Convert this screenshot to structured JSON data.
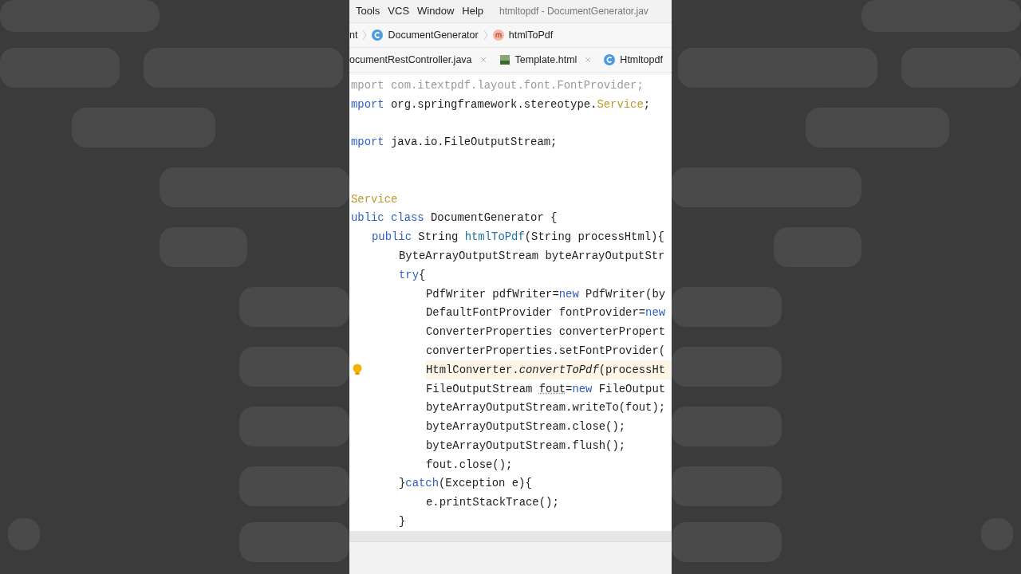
{
  "menu_bar": {
    "items": [
      "Tools",
      "VCS",
      "Window",
      "Help"
    ],
    "title": "htmltopdf - DocumentGenerator.jav"
  },
  "breadcrumbs": [
    {
      "label": "nt",
      "kind": "plain"
    },
    {
      "label": "DocumentGenerator",
      "kind": "class"
    },
    {
      "label": "htmlToPdf",
      "kind": "method"
    }
  ],
  "tabs": [
    {
      "label": "ocumentRestController.java",
      "kind": "plain",
      "closable": true
    },
    {
      "label": "Template.html",
      "kind": "html",
      "closable": true
    },
    {
      "label": "Htmltopdf",
      "kind": "class",
      "closable": false
    }
  ],
  "editor": {
    "lines": [
      {
        "kind": "code",
        "highlighted": false,
        "lightbulb": false,
        "tokens": [
          {
            "t": "mport com.itextpdf.layout.font.FontProvider;",
            "kind": "grey"
          }
        ]
      },
      {
        "kind": "code",
        "highlighted": false,
        "lightbulb": false,
        "tokens": [
          {
            "t": "mport",
            "kind": "kw"
          },
          {
            "t": " org.springframework.stereotype.",
            "kind": "plain"
          },
          {
            "t": "Service",
            "kind": "annot"
          },
          {
            "t": ";",
            "kind": "plain"
          }
        ]
      },
      {
        "kind": "blank"
      },
      {
        "kind": "code",
        "highlighted": false,
        "lightbulb": false,
        "tokens": [
          {
            "t": "mport",
            "kind": "kw"
          },
          {
            "t": " java.io.FileOutputStream;",
            "kind": "plain"
          }
        ]
      },
      {
        "kind": "blank"
      },
      {
        "kind": "blank"
      },
      {
        "kind": "code",
        "highlighted": false,
        "lightbulb": false,
        "tokens": [
          {
            "t": "Service",
            "kind": "annot"
          }
        ]
      },
      {
        "kind": "code",
        "highlighted": false,
        "lightbulb": false,
        "tokens": [
          {
            "t": "ublic class",
            "kind": "kw"
          },
          {
            "t": " DocumentGenerator {",
            "kind": "plain"
          }
        ],
        "children": [
          {
            "kind": "code",
            "highlighted": false,
            "lightbulb": false,
            "tokens": [
              {
                "t": "public",
                "kind": "kw"
              },
              {
                "t": " String ",
                "kind": "plain"
              },
              {
                "t": "htmlToPdf",
                "kind": "method"
              },
              {
                "t": "(String processHtml){",
                "kind": "plain"
              }
            ],
            "children": [
              {
                "kind": "code",
                "highlighted": false,
                "lightbulb": false,
                "tokens": [
                  {
                    "t": "ByteArrayOutputStream byteArrayOutputStr",
                    "kind": "plain"
                  }
                ]
              },
              {
                "kind": "code",
                "highlighted": false,
                "lightbulb": false,
                "tokens": [
                  {
                    "t": "try",
                    "kind": "kw"
                  },
                  {
                    "t": "{",
                    "kind": "plain"
                  }
                ],
                "children": [
                  {
                    "kind": "code",
                    "highlighted": false,
                    "lightbulb": false,
                    "tokens": [
                      {
                        "t": "PdfWriter pdfWriter=",
                        "kind": "plain"
                      },
                      {
                        "t": "new",
                        "kind": "kw"
                      },
                      {
                        "t": " PdfWriter(by",
                        "kind": "plain"
                      }
                    ]
                  },
                  {
                    "kind": "code",
                    "highlighted": false,
                    "lightbulb": false,
                    "tokens": [
                      {
                        "t": "DefaultFontProvider fontProvider=",
                        "kind": "plain"
                      },
                      {
                        "t": "new",
                        "kind": "kw"
                      }
                    ]
                  },
                  {
                    "kind": "code",
                    "highlighted": false,
                    "lightbulb": false,
                    "tokens": [
                      {
                        "t": "ConverterProperties converterPropert",
                        "kind": "plain"
                      }
                    ]
                  },
                  {
                    "kind": "code",
                    "highlighted": false,
                    "lightbulb": false,
                    "tokens": [
                      {
                        "t": "converterProperties.setFontProvider(",
                        "kind": "plain"
                      }
                    ]
                  },
                  {
                    "kind": "code",
                    "highlighted": true,
                    "lightbulb": true,
                    "tokens": [
                      {
                        "t": "HtmlConverter.",
                        "kind": "plain"
                      },
                      {
                        "t": "convertToPdf",
                        "kind": "italic"
                      },
                      {
                        "t": "(processHt",
                        "kind": "plain"
                      }
                    ]
                  },
                  {
                    "kind": "code",
                    "highlighted": false,
                    "lightbulb": false,
                    "tokens": [
                      {
                        "t": "FileOutputStream ",
                        "kind": "plain"
                      },
                      {
                        "t": "fout",
                        "kind": "warn"
                      },
                      {
                        "t": "=",
                        "kind": "plain"
                      },
                      {
                        "t": "new",
                        "kind": "kw"
                      },
                      {
                        "t": " FileOutput",
                        "kind": "plain"
                      }
                    ]
                  },
                  {
                    "kind": "code",
                    "highlighted": false,
                    "lightbulb": false,
                    "tokens": [
                      {
                        "t": "byteArrayOutputStream.writeTo(fout);",
                        "kind": "plain"
                      }
                    ]
                  },
                  {
                    "kind": "code",
                    "highlighted": false,
                    "lightbulb": false,
                    "tokens": [
                      {
                        "t": "byteArrayOutputStream.close();",
                        "kind": "plain"
                      }
                    ]
                  },
                  {
                    "kind": "code",
                    "highlighted": false,
                    "lightbulb": false,
                    "tokens": [
                      {
                        "t": "byteArrayOutputStream.flush();",
                        "kind": "plain"
                      }
                    ]
                  },
                  {
                    "kind": "code",
                    "highlighted": false,
                    "lightbulb": false,
                    "tokens": [
                      {
                        "t": "fout.close();",
                        "kind": "plain"
                      }
                    ]
                  }
                ]
              },
              {
                "kind": "code",
                "highlighted": false,
                "lightbulb": false,
                "tokens": [
                  {
                    "t": "}",
                    "kind": "plain"
                  },
                  {
                    "t": "catch",
                    "kind": "kw"
                  },
                  {
                    "t": "(Exception e){",
                    "kind": "plain"
                  }
                ],
                "children": [
                  {
                    "kind": "code",
                    "highlighted": false,
                    "lightbulb": false,
                    "tokens": [
                      {
                        "t": "e.printStackTrace();",
                        "kind": "plain"
                      }
                    ]
                  }
                ]
              },
              {
                "kind": "code",
                "highlighted": false,
                "lightbulb": false,
                "tokens": [
                  {
                    "t": "}",
                    "kind": "plain"
                  }
                ]
              }
            ]
          }
        ]
      }
    ]
  }
}
